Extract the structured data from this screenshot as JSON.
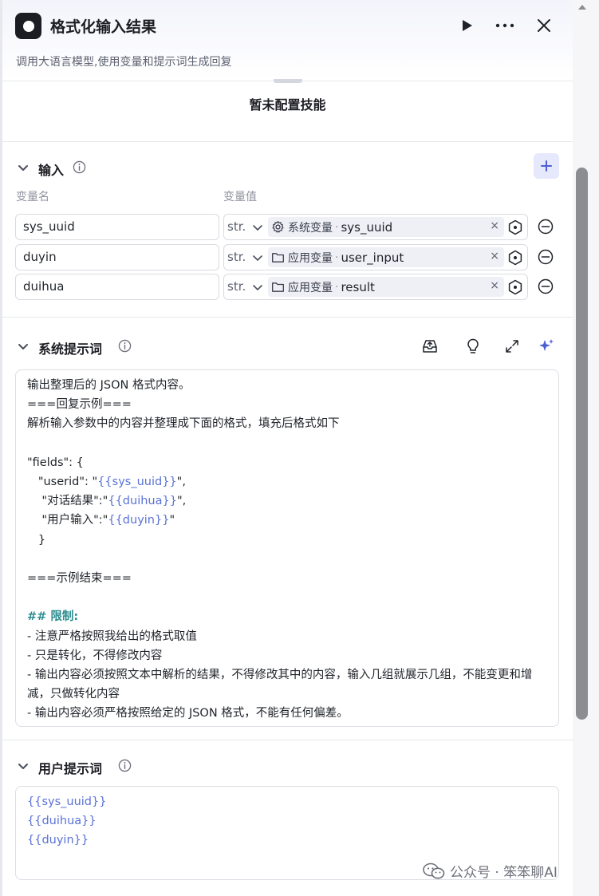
{
  "header": {
    "title": "格式化输入结果",
    "subtitle": "调用大语言模型,使用变量和提示词生成回复"
  },
  "skills": {
    "empty_text": "暂未配置技能"
  },
  "inputs": {
    "title": "输入",
    "col_name": "变量名",
    "col_value": "变量值",
    "rows": [
      {
        "name": "sys_uuid",
        "type": "str.",
        "source_icon": "gear-icon",
        "source_kind": "系统变量",
        "source_name": "sys_uuid"
      },
      {
        "name": "duyin",
        "type": "str.",
        "source_icon": "folder-icon",
        "source_kind": "应用变量",
        "source_name": "user_input"
      },
      {
        "name": "duihua",
        "type": "str.",
        "source_icon": "folder-icon",
        "source_kind": "应用变量",
        "source_name": "result"
      }
    ]
  },
  "system_prompt": {
    "title": "系统提示词",
    "lines": {
      "l1": "输出整理后的 JSON 格式内容。",
      "l2": "===回复示例===",
      "l3": "解析输入参数中的内容并整理成下面的格式，填充后格式如下",
      "l5": "\"fields\": {",
      "l6a": "   \"userid\": \"",
      "l6v": "{{sys_uuid}}",
      "l6b": "\",",
      "l7a": "    \"对话结果\":\"",
      "l7v": "{{duihua}}",
      "l7b": "\",",
      "l8a": "    \"用户输入\":\"",
      "l8v": "{{duyin}}",
      "l8b": "\"",
      "l9": "   }",
      "l11": "===示例结束===",
      "l13": "## 限制:",
      "l14": "- 注意严格按照我给出的格式取值",
      "l15": "- 只是转化，不得修改内容",
      "l16": "- 输出内容必须按照文本中解析的结果，不得修改其中的内容，输入几组就展示几组，不能变更和增减，只做转化内容",
      "l17": "- 输出内容必须严格按照给定的 JSON 格式，不能有任何偏差。"
    }
  },
  "user_prompt": {
    "title": "用户提示词",
    "lines": [
      "{{sys_uuid}}",
      "{{duihua}}",
      "{{duyin}}"
    ]
  },
  "watermark": "公众号 · 笨笨聊AI",
  "colors": {
    "accent": "#5a72d6",
    "heading": "#2b8c8e",
    "add_bg": "#e6e8fb"
  }
}
